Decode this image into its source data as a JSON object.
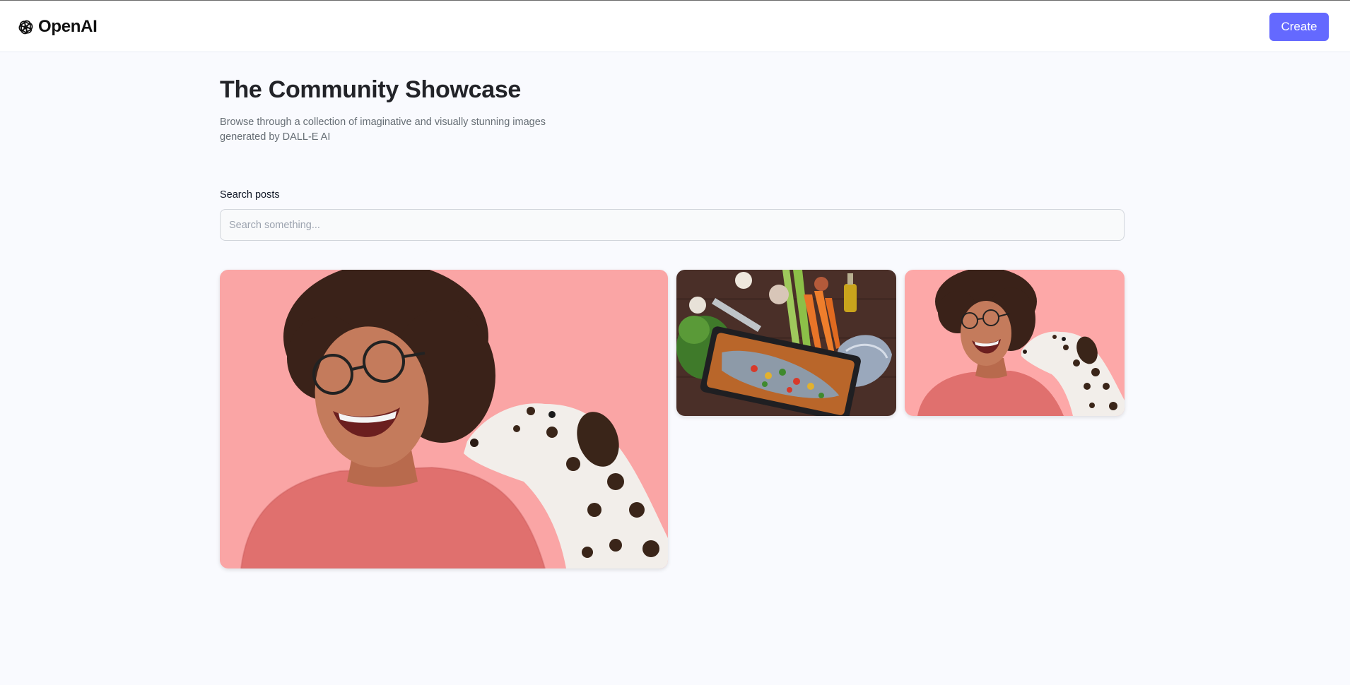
{
  "header": {
    "logo_text": "OpenAI",
    "logo_icon": "openai-logo-icon",
    "create_label": "Create"
  },
  "main": {
    "title": "The Community Showcase",
    "subtitle": "Browse through a collection of imaginative and visually stunning images generated by DALL-E AI",
    "search": {
      "label": "Search posts",
      "placeholder": "Search something...",
      "value": ""
    },
    "gallery": [
      {
        "subject": "laughing-woman-with-dalmatian"
      },
      {
        "subject": "baked-fish-with-vegetables"
      },
      {
        "subject": "laughing-woman-with-dalmatian"
      }
    ]
  },
  "colors": {
    "accent": "#6469ff",
    "page_bg": "#f9fafe",
    "title": "#222328",
    "subtitle": "#666e75",
    "photo_pink_bg": "#fda8a8"
  }
}
